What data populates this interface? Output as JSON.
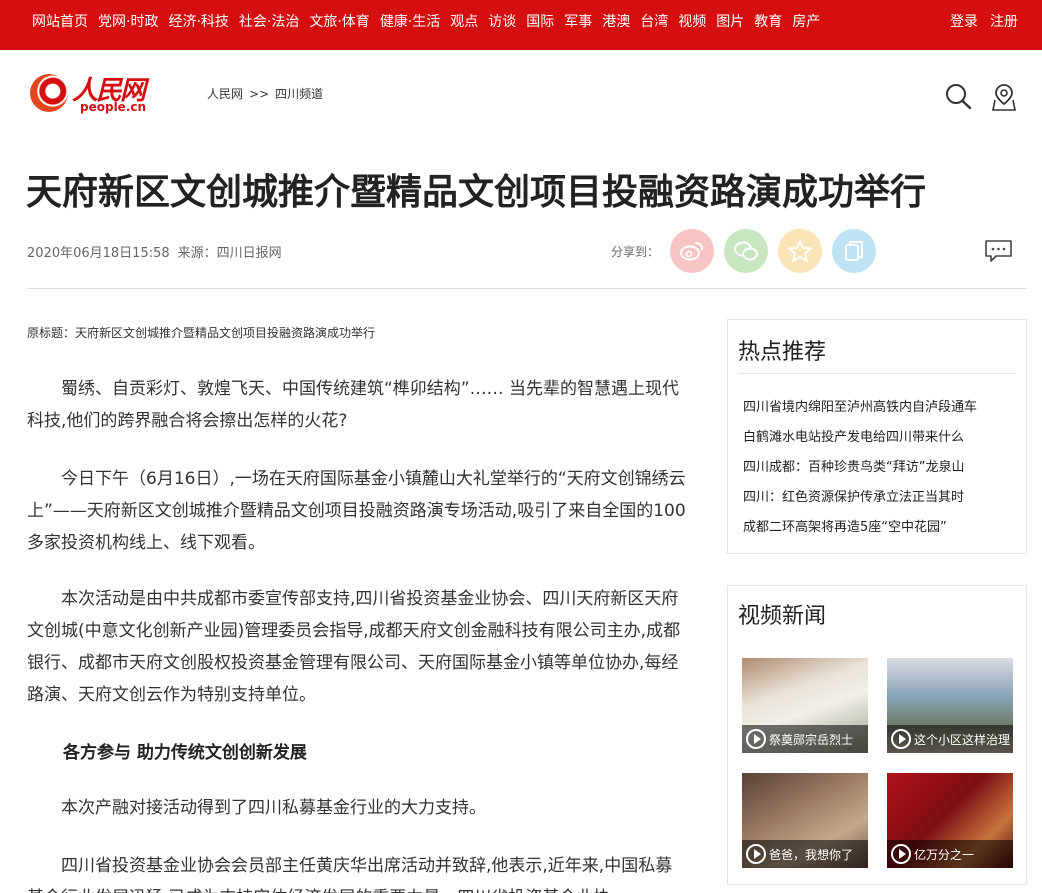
{
  "topnav": {
    "items": [
      "网站首页",
      "党网·时政",
      "经济·科技",
      "社会·法治",
      "文旅·体育",
      "健康·生活",
      "观点",
      "访谈",
      "国际",
      "军事",
      "港澳",
      "台湾",
      "视频",
      "图片",
      "教育",
      "房产"
    ],
    "login": "登录",
    "register": "注册"
  },
  "header": {
    "logo_cn": "人民网",
    "logo_en": "people.cn",
    "breadcrumb": [
      "人民网",
      ">>",
      "四川频道"
    ]
  },
  "article": {
    "title": "天府新区文创城推介暨精品文创项目投融资路演成功举行",
    "date": "2020年06月18日15:58",
    "source": "来源：四川日报网",
    "share_label": "分享到：",
    "original_title": "原标题：天府新区文创城推介暨精品文创项目投融资路演成功举行",
    "paragraphs": [
      "蜀绣、自贡彩灯、敦煌飞天、中国传统建筑“榫卯结构”…… 当先辈的智慧遇上现代科技,他们的跨界融合将会擦出怎样的火花?",
      "今日下午（6月16日）,一场在天府国际基金小镇麓山大礼堂举行的“天府文创锦绣云上”——天府新区文创城推介暨精品文创项目投融资路演专场活动,吸引了来自全国的100多家投资机构线上、线下观看。",
      "本次活动是由中共成都市委宣传部支持,四川省投资基金业协会、四川天府新区天府文创城(中意文化创新产业园)管理委员会指导,成都天府文创金融科技有限公司主办,成都银行、成都市天府文创股权投资基金管理有限公司、天府国际基金小镇等单位协办,每经路演、天府文创云作为特别支持单位。",
      "各方参与 助力传统文创创新发展",
      "本次产融对接活动得到了四川私募基金行业的大力支持。",
      "四川省投资基金业协会会员部主任黄庆华出席活动并致辞,他表示,近年来,中国私募基金行业发展迅猛,已成为支持实体经济发展的重要力量。四川省投资基金业协"
    ]
  },
  "sidebar": {
    "hot_title": "热点推荐",
    "hot_items": [
      "四川省境内绵阳至泸州高铁内自泸段通车",
      "白鹤滩水电站投产发电给四川带来什么",
      "四川成都：百种珍贵鸟类“拜访”龙泉山",
      "四川：红色资源保护传承立法正当其时",
      "成都二环高架将再造5座“空中花园”"
    ],
    "video_title": "视频新闻",
    "videos": [
      "祭奠郧宗岳烈士",
      "这个小区这样治理",
      "爸爸，我想你了",
      "亿万分之一"
    ]
  },
  "colors": {
    "brand_red": "#d50f0f",
    "weibo": "#f7c4c4",
    "wechat": "#c8e6c0",
    "qzone": "#fbe3b8",
    "copy": "#bfe3f5"
  }
}
